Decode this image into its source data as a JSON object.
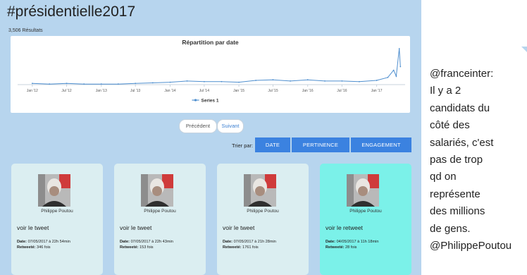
{
  "header": {
    "title": "#présidentielle2017",
    "result_count": "3,506 Résultats"
  },
  "chart_data": {
    "type": "line",
    "title": "Répartition par date",
    "xlabel": "",
    "ylabel": "",
    "x": [
      "2012-01-01",
      "2012-04-01",
      "2012-07-01",
      "2012-10-01",
      "2013-01-01",
      "2013-04-01",
      "2013-07-01",
      "2013-10-01",
      "2014-01-01",
      "2014-04-01",
      "2014-07-01",
      "2014-10-01",
      "2015-01-01",
      "2015-04-01",
      "2015-07-01",
      "2015-10-01",
      "2016-01-01",
      "2016-04-01",
      "2016-07-01",
      "2016-10-01",
      "2017-01-01",
      "2017-03-01",
      "2017-04-01",
      "2017-04-15",
      "2017-05-01",
      "2017-05-07"
    ],
    "series": [
      {
        "name": "Series 1",
        "values": [
          2,
          1,
          2,
          1,
          1,
          1,
          2,
          3,
          4,
          6,
          5,
          5,
          4,
          7,
          8,
          6,
          8,
          6,
          6,
          5,
          7,
          12,
          24,
          14,
          60,
          30
        ]
      }
    ],
    "x_tick_labels": [
      "Jan '12",
      "Jul '12",
      "Jan '13",
      "Jul '13",
      "Jan '14",
      "Jul '14",
      "Jan '15",
      "Jul '15",
      "Jan '16",
      "Jul '16",
      "Jan '17"
    ],
    "legend_position": "bottom-center",
    "grid": false,
    "line_color": "#4f8fcf"
  },
  "pagination": {
    "prev": "Précédent",
    "next": "Suivant"
  },
  "sort": {
    "label": "Trier par:",
    "options": [
      "DATE",
      "PERTINENCE",
      "ENGAGEMENT"
    ]
  },
  "cards": [
    {
      "name": "Philippe Poutou",
      "link": "voir le tweet",
      "date_label": "Date:",
      "date": "07/05/2017 à 22h 54min",
      "retweet_label": "Retweeté:",
      "retweets": "346 fois",
      "highlight": false
    },
    {
      "name": "Philippe Poutou",
      "link": "voir le tweet",
      "date_label": "Date:",
      "date": "07/05/2017 à 22h 43min",
      "retweet_label": "Retweeté:",
      "retweets": "153 fois",
      "highlight": false
    },
    {
      "name": "Philippe Poutou",
      "link": "voir le tweet",
      "date_label": "Date:",
      "date": "07/05/2017 à 21h 28min",
      "retweet_label": "Retweeté:",
      "retweets": "1761 fois",
      "highlight": false
    },
    {
      "name": "Philippe Poutou",
      "link": "voir le retweet",
      "date_label": "Date:",
      "date": "04/05/2017 à 11h 18min",
      "retweet_label": "Retweeté:",
      "retweets": "28 fois",
      "highlight": true
    }
  ],
  "tweet_panel": {
    "text": "@franceinter:\nIl y a 2\ncandidats du\ncôté des\nsalariés, c'est\npas de trop\nqd on\nreprésente\ndes millions\nde gens.\n@PhilippePoutou"
  },
  "colors": {
    "app_bg": "#b7d5ee",
    "accent": "#3b82e0",
    "card_bg": "#dbeef1",
    "card_highlight": "#7bf1e9"
  }
}
